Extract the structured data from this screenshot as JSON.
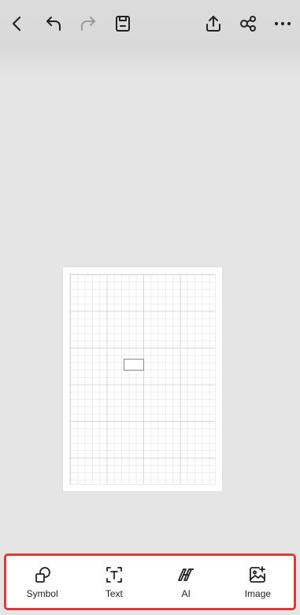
{
  "toolbar": {
    "icons": [
      "back-icon",
      "undo-icon",
      "redo-icon",
      "save-icon",
      "export-icon",
      "share-icon",
      "more-icon"
    ],
    "redo_enabled": false
  },
  "bottom_tools": [
    {
      "label": "Symbol",
      "icon": "symbol-icon"
    },
    {
      "label": "Text",
      "icon": "text-icon"
    },
    {
      "label": "AI",
      "icon": "ai-icon"
    },
    {
      "label": "Image",
      "icon": "image-add-icon"
    }
  ],
  "colors": {
    "background": "#e5e5e5",
    "toolbar": "#dcdcdc",
    "highlight_border": "#d93a3a",
    "icon": "#222222",
    "disabled_icon": "#9a9a9a"
  }
}
